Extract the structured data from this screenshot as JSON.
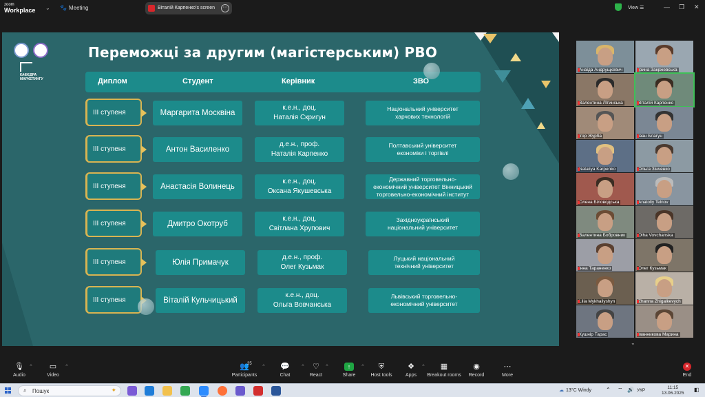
{
  "topbar": {
    "brand_line1": "zoom",
    "brand_line2": "Workplace",
    "meeting": "Meeting",
    "share_label": "Віталій Карпенко's screen",
    "view": "View"
  },
  "slide": {
    "title": "Переможці за другим (магістерським) РВО",
    "logo_text": "КАФЕДРА МАРКЕТИНГУ",
    "headers": [
      "Диплом",
      "Студент",
      "Керівник",
      "ЗВО"
    ],
    "rows": [
      {
        "diploma": "ІІІ ступеня",
        "student": "Маргарита Москвіна",
        "supervisor": [
          "к.е.н., доц.",
          "Наталія Скригун"
        ],
        "university": [
          "Національний університет",
          "харчових технологій"
        ]
      },
      {
        "diploma": "ІІІ ступеня",
        "student": "Антон Василенко",
        "supervisor": [
          "д.е.н., проф.",
          "Наталія Карпенко"
        ],
        "university": [
          "Полтавський університет",
          "економіки і торгівлі"
        ]
      },
      {
        "diploma": "ІІІ ступеня",
        "student": "Анастасія Волинець",
        "supervisor": [
          "к.е.н., доц.",
          "Оксана Якушевська"
        ],
        "university": [
          "Державний торговельно-",
          "економічний університет Вінницький",
          "торговельно-економічний інститут"
        ]
      },
      {
        "diploma": "ІІІ ступеня",
        "student": "Дмитро Окотруб",
        "supervisor": [
          "к.е.н., доц.",
          "Світлана Хрупович"
        ],
        "university": [
          "Західноукраїнський",
          "національний університет"
        ]
      },
      {
        "diploma": "ІІІ ступеня",
        "student": "Юлія Примачук",
        "supervisor": [
          "д.е.н., проф.",
          "Олег Кузьмак"
        ],
        "university": [
          "Луцький національний",
          "технічний університет"
        ]
      },
      {
        "diploma": "ІІІ ступеня",
        "student": "Віталій Кульчицький",
        "supervisor": [
          "к.е.н., доц.",
          "Ольга Вовчанська"
        ],
        "university": [
          "Львівський торговельно-",
          "економічний університет"
        ]
      }
    ]
  },
  "participants": [
    "Анаіда Андрущкевич",
    "Ірина Закржевська",
    "Валентина Літинська",
    "Віталій Карпенко",
    "Ігор Журба",
    "Іван Благун",
    "Nataliya Karpenko",
    "Ольга Зінченко",
    "Олена Біловодська",
    "Anatoliy Telnov",
    "Валентина Бобровник",
    "Olha Vovchanska",
    "Інна Тараненко",
    "Олег Кузьмак",
    "Lilia Mykhailyshyn",
    "Zhanna Zhigalkevych",
    "Кушнір Тарас",
    "Іванникова Марина"
  ],
  "toolbar": {
    "audio": "Audio",
    "video": "Video",
    "participants": "Participants",
    "participants_count": "35",
    "chat": "Chat",
    "react": "React",
    "share": "Share",
    "host_tools": "Host tools",
    "apps": "Apps",
    "breakout": "Breakout rooms",
    "record": "Record",
    "more": "More",
    "end": "End"
  },
  "taskbar": {
    "search": "Пошук",
    "weather": "13°C  Windy",
    "lang": "УКР",
    "time": "11:15",
    "date": "13.06.2025"
  },
  "colors": {
    "slide_bg": "#2b666a",
    "cell_bg": "#1c8b8b",
    "accent_gold": "#d9b451",
    "end_red": "#d7262b",
    "share_green": "#1fa543"
  }
}
